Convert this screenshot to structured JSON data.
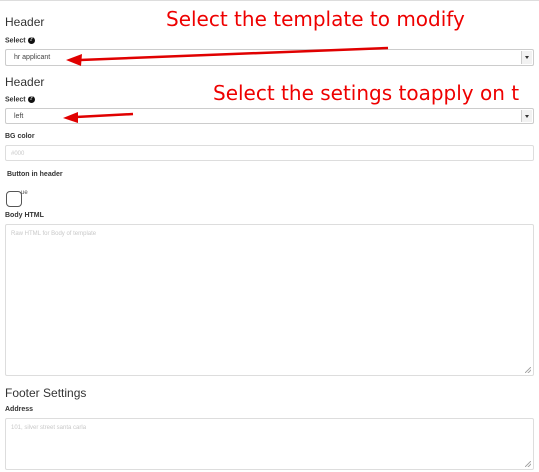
{
  "header_section_1": {
    "title": "Header",
    "select_label": "Select",
    "select_value": "hr applicant"
  },
  "header_section_2": {
    "title": "Header",
    "select_label": "Select",
    "select_value": "left"
  },
  "bg_color": {
    "label": "BG color",
    "placeholder": "#000"
  },
  "button_in_header": {
    "label": "Button  in header",
    "checkbox_text": "ue"
  },
  "body_html": {
    "label": "Body HTML",
    "placeholder": "Raw HTML for Body of template"
  },
  "footer": {
    "title": "Footer Settings",
    "address_label": "Address",
    "address_placeholder": "101, silver street santa carla"
  },
  "annotations": {
    "note_1": "Select the template to modify",
    "note_2": "Select the setings toapply on t",
    "color": "#e00000"
  },
  "icons": {
    "help": "help-icon",
    "dropdown": "chevron-down-icon"
  }
}
